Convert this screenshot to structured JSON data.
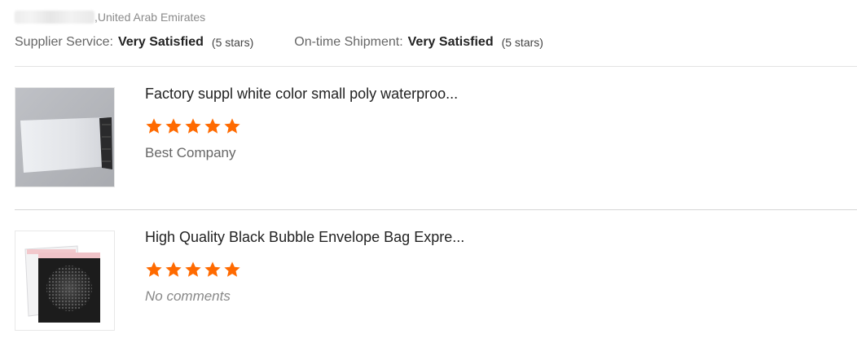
{
  "header": {
    "country": ",United Arab Emirates",
    "supplier_service": {
      "label": "Supplier Service:",
      "value": "Very Satisfied",
      "stars_text": "(5 stars)"
    },
    "on_time_shipment": {
      "label": "On-time Shipment:",
      "value": "Very Satisfied",
      "stars_text": "(5 stars)"
    }
  },
  "reviews": [
    {
      "title": "Factory suppl white color small poly waterproo...",
      "rating": 5,
      "comment": "Best Company",
      "image_icon": "white-poly-mailer-bag-image"
    },
    {
      "title": "High Quality Black Bubble Envelope Bag Expre...",
      "rating": 5,
      "comment": "No comments",
      "image_icon": "black-bubble-envelope-image"
    }
  ],
  "colors": {
    "star": "#ff6a00",
    "divider": "#e3e3e3"
  }
}
